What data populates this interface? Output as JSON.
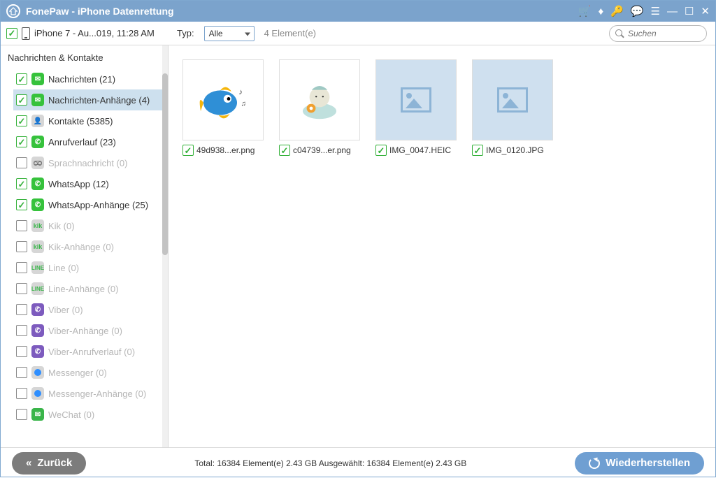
{
  "title": "FonePaw - iPhone Datenrettung",
  "device_label": "iPhone 7 - Au...019, 11:28 AM",
  "filter": {
    "typ_label": "Typ:",
    "selected": "Alle",
    "count": "4 Element(e)"
  },
  "search_placeholder": "Suchen",
  "sidebar": {
    "section": "Nachrichten & Kontakte",
    "items": [
      {
        "label": "Nachrichten (21)",
        "checked": true,
        "icon": "b-green",
        "glyph": "✉",
        "disabled": false,
        "sel": false
      },
      {
        "label": "Nachrichten-Anhänge (4)",
        "checked": true,
        "icon": "b-green",
        "glyph": "✉",
        "disabled": false,
        "sel": true
      },
      {
        "label": "Kontakte (5385)",
        "checked": true,
        "icon": "b-grey contact",
        "glyph": "👤",
        "disabled": false,
        "sel": false
      },
      {
        "label": "Anrufverlauf (23)",
        "checked": true,
        "icon": "b-green",
        "glyph": "✆",
        "disabled": false,
        "sel": false
      },
      {
        "label": "Sprachnachricht (0)",
        "checked": false,
        "icon": "b-vm",
        "glyph": "",
        "disabled": true,
        "sel": false
      },
      {
        "label": "WhatsApp (12)",
        "checked": true,
        "icon": "b-green",
        "glyph": "✆",
        "disabled": false,
        "sel": false
      },
      {
        "label": "WhatsApp-Anhänge (25)",
        "checked": true,
        "icon": "b-green",
        "glyph": "✆",
        "disabled": false,
        "sel": false
      },
      {
        "label": "Kik (0)",
        "checked": false,
        "icon": "b-kik",
        "glyph": "kik",
        "disabled": true,
        "sel": false
      },
      {
        "label": "Kik-Anhänge (0)",
        "checked": false,
        "icon": "b-kik",
        "glyph": "kik",
        "disabled": true,
        "sel": false
      },
      {
        "label": "Line (0)",
        "checked": false,
        "icon": "b-line",
        "glyph": "LINE",
        "disabled": true,
        "sel": false
      },
      {
        "label": "Line-Anhänge (0)",
        "checked": false,
        "icon": "b-line",
        "glyph": "LINE",
        "disabled": true,
        "sel": false
      },
      {
        "label": "Viber (0)",
        "checked": false,
        "icon": "b-viber",
        "glyph": "✆",
        "disabled": true,
        "sel": false
      },
      {
        "label": "Viber-Anhänge (0)",
        "checked": false,
        "icon": "b-viber",
        "glyph": "✆",
        "disabled": true,
        "sel": false
      },
      {
        "label": "Viber-Anrufverlauf (0)",
        "checked": false,
        "icon": "b-viber",
        "glyph": "✆",
        "disabled": true,
        "sel": false
      },
      {
        "label": "Messenger (0)",
        "checked": false,
        "icon": "b-msg",
        "glyph": "",
        "disabled": true,
        "sel": false
      },
      {
        "label": "Messenger-Anhänge (0)",
        "checked": false,
        "icon": "b-msg",
        "glyph": "",
        "disabled": true,
        "sel": false
      },
      {
        "label": "WeChat (0)",
        "checked": false,
        "icon": "b-wechat",
        "glyph": "✉",
        "disabled": true,
        "sel": false
      }
    ]
  },
  "thumbs": [
    {
      "name": "49d938...er.png",
      "kind": "fish",
      "checked": true
    },
    {
      "name": "c04739...er.png",
      "kind": "cartoon",
      "checked": true
    },
    {
      "name": "IMG_0047.HEIC",
      "kind": "placeholder",
      "checked": true
    },
    {
      "name": "IMG_0120.JPG",
      "kind": "placeholder",
      "checked": true
    }
  ],
  "footer": {
    "back": "Zurück",
    "restore": "Wiederherstellen",
    "summary": "Total: 16384 Element(e) 2.43 GB   Ausgewählt: 16384 Element(e) 2.43 GB"
  }
}
